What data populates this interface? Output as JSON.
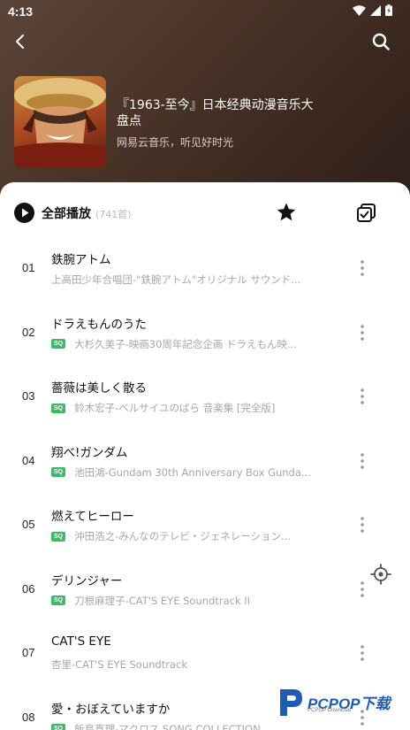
{
  "status_bar": {
    "time": "4:13"
  },
  "header": {
    "playlist_title": "『1963-至今』日本经典动漫音乐大盘点",
    "playlist_subtitle": "网易云音乐，听见好时光"
  },
  "toolbar": {
    "play_all_label": "全部播放",
    "play_all_count": "(741首)"
  },
  "songs": [
    {
      "num": "01",
      "title": "鉄腕アトム",
      "sq": false,
      "artist": "上高田少年合唱団-\"鉄腕アトム\"オリジナル サウンド..."
    },
    {
      "num": "02",
      "title": "ドラえもんのうた",
      "sq": true,
      "sq_label": "SQ",
      "artist": "大杉久美子-映画30周年記念企画 ドラえもん映..."
    },
    {
      "num": "03",
      "title": "薔薇は美しく散る",
      "sq": true,
      "sq_label": "SQ",
      "artist": "鈴木宏子-ベルサイユのばら 音楽集 [完全版]"
    },
    {
      "num": "04",
      "title": "翔べ!ガンダム",
      "sq": true,
      "sq_label": "SQ",
      "artist": "池田鴻-Gundam 30th Anniversary Box Gundam..."
    },
    {
      "num": "05",
      "title": "燃えてヒーロー",
      "sq": true,
      "sq_label": "SQ",
      "artist": "沖田浩之-みんなのテレビ・ジェネレーション..."
    },
    {
      "num": "06",
      "title": "デリンジャー",
      "sq": true,
      "sq_label": "SQ",
      "artist": "刀根麻理子-CAT'S EYE Soundtrack II"
    },
    {
      "num": "07",
      "title": "CAT'S EYE",
      "sq": false,
      "artist": "杏里-CAT'S EYE Soundtrack"
    },
    {
      "num": "08",
      "title": "愛・おぼえていますか",
      "sq": true,
      "sq_label": "SQ",
      "artist": "飯島真理-マクロス SONG COLLECTION"
    }
  ],
  "watermark": {
    "brand": "PCPOP下载",
    "sub": "PCPOP Download"
  }
}
